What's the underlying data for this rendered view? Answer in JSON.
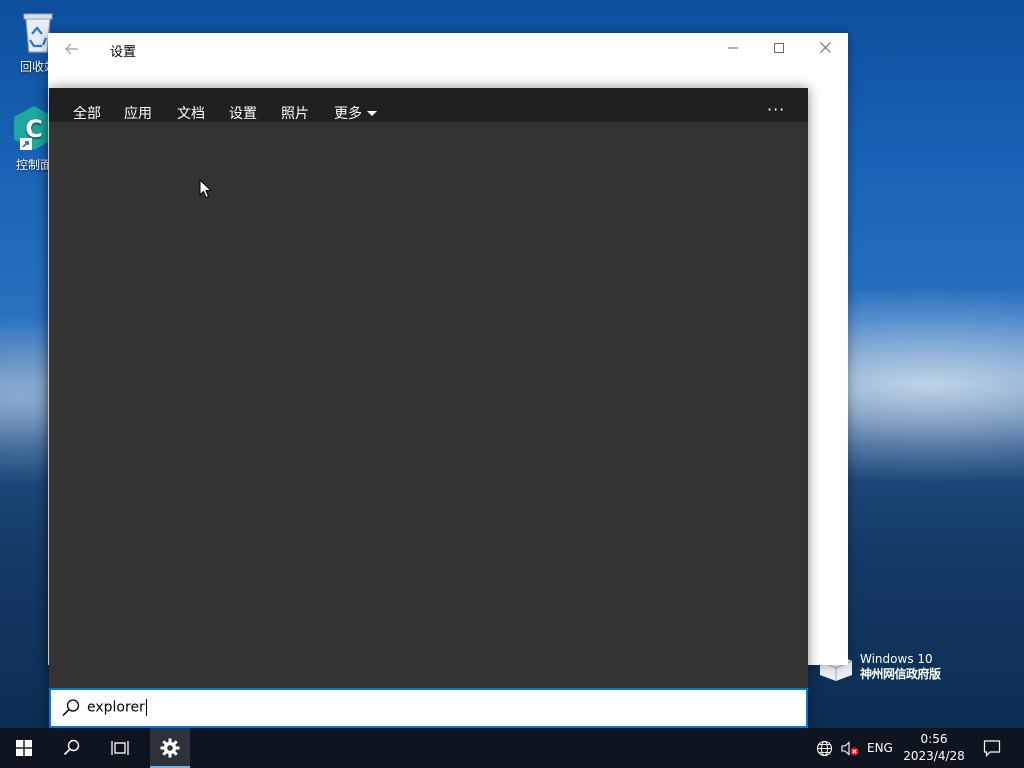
{
  "desktop": {
    "icons": [
      {
        "label": "回收站",
        "icon": "recycle-bin-icon"
      },
      {
        "label": "控制面板",
        "icon": "control-panel-icon"
      }
    ],
    "watermark": {
      "line1": "Windows 10",
      "line2": "神州网信政府版"
    }
  },
  "settings_window": {
    "title": "设置",
    "back_icon": "back-arrow-icon",
    "minimize_icon": "minimize-icon",
    "maximize_icon": "maximize-icon",
    "close_icon": "close-icon"
  },
  "search_flyout": {
    "tabs": [
      {
        "label": "全部",
        "active": true
      },
      {
        "label": "应用",
        "active": false
      },
      {
        "label": "文档",
        "active": false
      },
      {
        "label": "设置",
        "active": false
      },
      {
        "label": "照片",
        "active": false
      },
      {
        "label": "更多",
        "active": false,
        "dropdown": true
      }
    ],
    "more_options": "···",
    "search_box": {
      "value": "explorer",
      "icon": "search-icon"
    }
  },
  "taskbar": {
    "start_icon": "windows-start-icon",
    "search_icon": "search-icon",
    "taskview_icon": "task-view-icon",
    "pinned": [
      {
        "app": "设置",
        "icon": "gear-icon",
        "active": true
      }
    ],
    "tray": {
      "network_icon": "globe-network-icon",
      "volume_icon": "volume-muted-icon",
      "language": "ENG",
      "time": "0:56",
      "date": "2023/4/28",
      "notification_icon": "action-center-icon"
    }
  },
  "colors": {
    "accent": "#0078d7",
    "flyout_bg": "#333333",
    "flyout_tabbar": "#202020",
    "taskbar": "#0f1520"
  }
}
